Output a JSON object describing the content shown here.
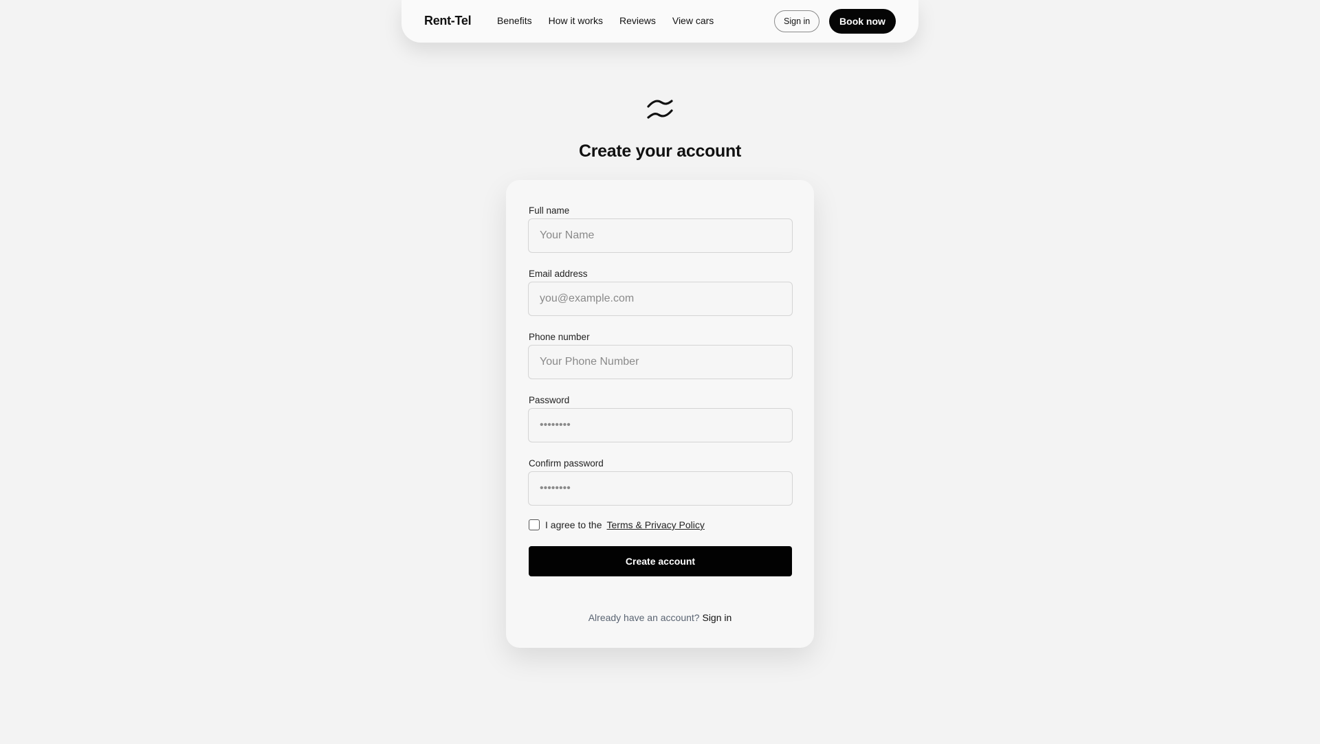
{
  "nav": {
    "brand": "Rent-Tel",
    "links": [
      "Benefits",
      "How it works",
      "Reviews",
      "View cars"
    ],
    "sign_in": "Sign in",
    "book_now": "Book now"
  },
  "page": {
    "logo_icon": "wave-logo-icon",
    "title": "Create your account"
  },
  "form": {
    "full_name": {
      "label": "Full name",
      "placeholder": "Your Name",
      "value": ""
    },
    "email": {
      "label": "Email address",
      "placeholder": "you@example.com",
      "value": ""
    },
    "phone": {
      "label": "Phone number",
      "placeholder": "Your Phone Number",
      "value": ""
    },
    "password": {
      "label": "Password",
      "placeholder": "••••••••",
      "value": ""
    },
    "confirm_password": {
      "label": "Confirm password",
      "placeholder": "••••••••",
      "value": ""
    },
    "agree_prefix": "I agree to the",
    "terms_link": "Terms & Privacy Policy",
    "agree_checked": false,
    "submit": "Create account",
    "already_text": "Already have an account?",
    "sign_in_link": "Sign in"
  }
}
